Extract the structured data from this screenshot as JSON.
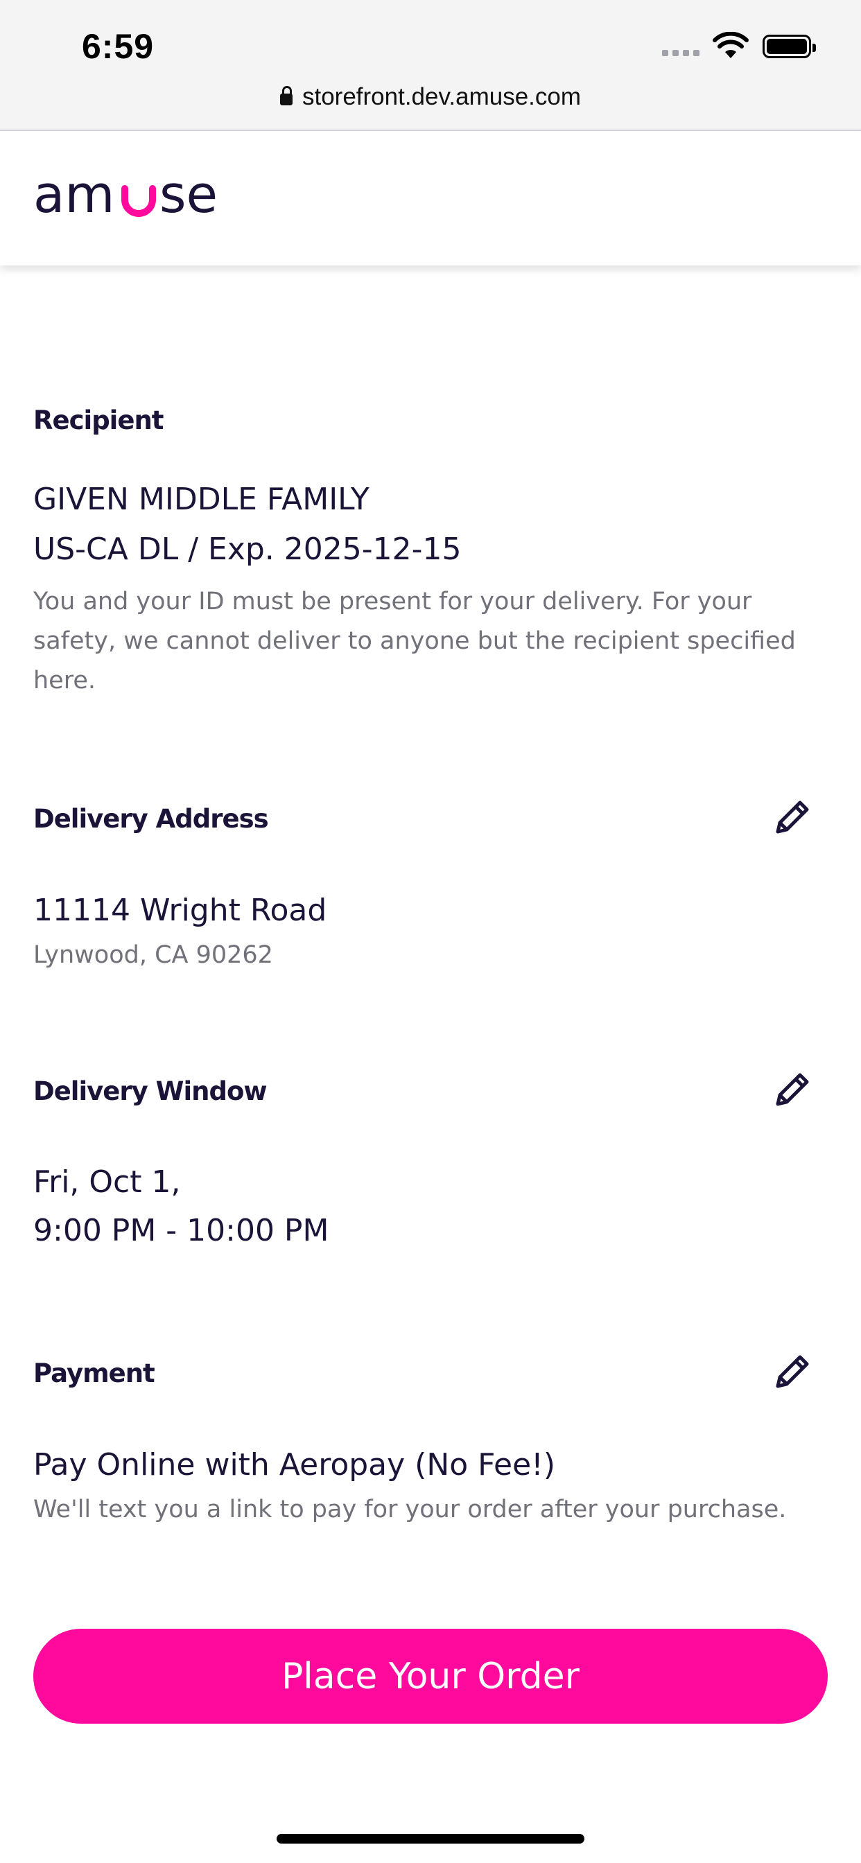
{
  "status_bar": {
    "time": "6:59"
  },
  "browser": {
    "url": "storefront.dev.amuse.com"
  },
  "brand": {
    "name": "amuse",
    "accent_color": "#ff0a9d",
    "text_color": "#1c1438"
  },
  "recipient": {
    "label": "Recipient",
    "name": "GIVEN MIDDLE FAMILY",
    "id_info": "US-CA DL / Exp. 2025-12-15",
    "note": "You and your ID must be present for your delivery. For your safety, we cannot deliver to anyone but the recipient specified here."
  },
  "delivery_address": {
    "label": "Delivery Address",
    "street": "11114 Wright Road",
    "city_line": "Lynwood, CA 90262"
  },
  "delivery_window": {
    "label": "Delivery Window",
    "date": "Fri, Oct 1,",
    "time_range": "9:00 PM - 10:00 PM"
  },
  "payment": {
    "label": "Payment",
    "method": "Pay Online with Aeropay (No Fee!)",
    "note": "We'll text you a link to pay for your order after your purchase."
  },
  "actions": {
    "place_order_label": "Place Your Order"
  },
  "icons": [
    "lock-icon",
    "wifi-icon",
    "battery-icon",
    "edit-pencil-icon"
  ]
}
